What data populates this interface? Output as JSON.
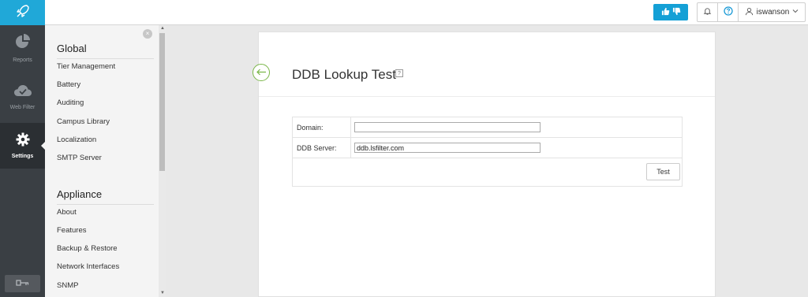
{
  "app": {
    "brand_color": "#20a8d8",
    "logo_icon": "rocket-icon"
  },
  "topbar": {
    "feedback_icon": "thumbs-up-down-icon",
    "bell_icon": "bell-icon",
    "help_icon": "help-icon",
    "user_icon": "user-icon",
    "username": "iswanson",
    "dropdown_icon": "chevron-down-icon"
  },
  "leftnav": {
    "items": [
      {
        "label": "Reports",
        "icon": "pie-chart-icon"
      },
      {
        "label": "Web Filter",
        "icon": "cloud-check-icon"
      },
      {
        "label": "Settings",
        "icon": "gear-icon",
        "active": true
      }
    ],
    "lock_icon": "key-icon"
  },
  "sidebar": {
    "close_label": "×",
    "sections": [
      {
        "title": "Global",
        "items": [
          "Tier Management",
          "Battery",
          "Auditing",
          "Campus Library",
          "Localization",
          "SMTP Server"
        ]
      },
      {
        "title": "Appliance",
        "items": [
          "About",
          "Features",
          "Backup & Restore",
          "Network Interfaces",
          "SNMP"
        ]
      }
    ]
  },
  "main": {
    "back_icon": "arrow-left-icon",
    "title": "DDB Lookup Test",
    "help_label": "?",
    "form": {
      "domain_label": "Domain:",
      "domain_value": "",
      "server_label": "DDB Server:",
      "server_value": "ddb.lsfilter.com",
      "test_label": "Test"
    }
  }
}
